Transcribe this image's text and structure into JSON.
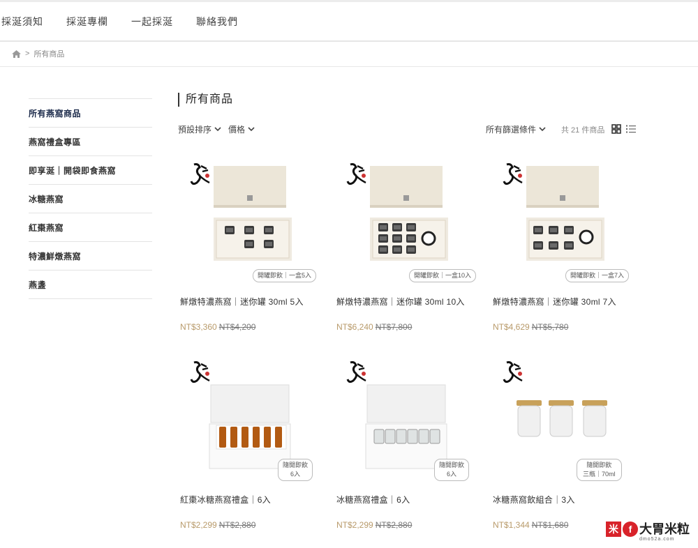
{
  "nav": [
    "採涎須知",
    "採涎專欄",
    "一起採涎",
    "聯絡我們"
  ],
  "breadcrumb": {
    "home_icon": "home-icon",
    "sep": ">",
    "current": "所有商品"
  },
  "sidebar": [
    "所有燕窩商品",
    "燕窩禮盒專區",
    "即享涎｜開袋即食燕窩",
    "冰糖燕窩",
    "紅棗燕窩",
    "特濃鮮燉燕窩",
    "燕盞"
  ],
  "page_title": "所有商品",
  "filters": {
    "sort": "預設排序",
    "price": "價格",
    "all_filters": "所有篩選條件",
    "count": "共 21 件商品"
  },
  "colors": {
    "price": "#b89a6a",
    "box": "#ece6d8",
    "brand_red": "#d8232a"
  },
  "products": [
    {
      "name": "鮮燉特濃燕窩｜迷你罐 30ml 5入",
      "price": "NT$3,360",
      "orig": "NT$4,200",
      "tag": "開罐即飲｜一盒5入"
    },
    {
      "name": "鮮燉特濃燕窩｜迷你罐 30ml 10入",
      "price": "NT$6,240",
      "orig": "NT$7,800",
      "tag": "開罐即飲｜一盒10入"
    },
    {
      "name": "鮮燉特濃燕窩｜迷你罐 30ml 7入",
      "price": "NT$4,629",
      "orig": "NT$5,780",
      "tag": "開罐即飲｜一盒7入"
    },
    {
      "name": "紅棗冰糖燕窩禮盒｜6入",
      "price": "NT$2,299",
      "orig": "NT$2,880",
      "tag1": "隨開即飲",
      "tag2": "6入"
    },
    {
      "name": "冰糖燕窩禮盒｜6入",
      "price": "NT$2,299",
      "orig": "NT$2,880",
      "tag1": "隨開即飲",
      "tag2": "6入"
    },
    {
      "name": "冰糖燕窩飲組合｜3入",
      "price": "NT$1,344",
      "orig": "NT$1,680",
      "tag1": "隨開即飲",
      "tag2": "三瓶｜70ml"
    }
  ],
  "watermark": {
    "main": "大胃米粒",
    "sub": "dmo52a.com"
  }
}
